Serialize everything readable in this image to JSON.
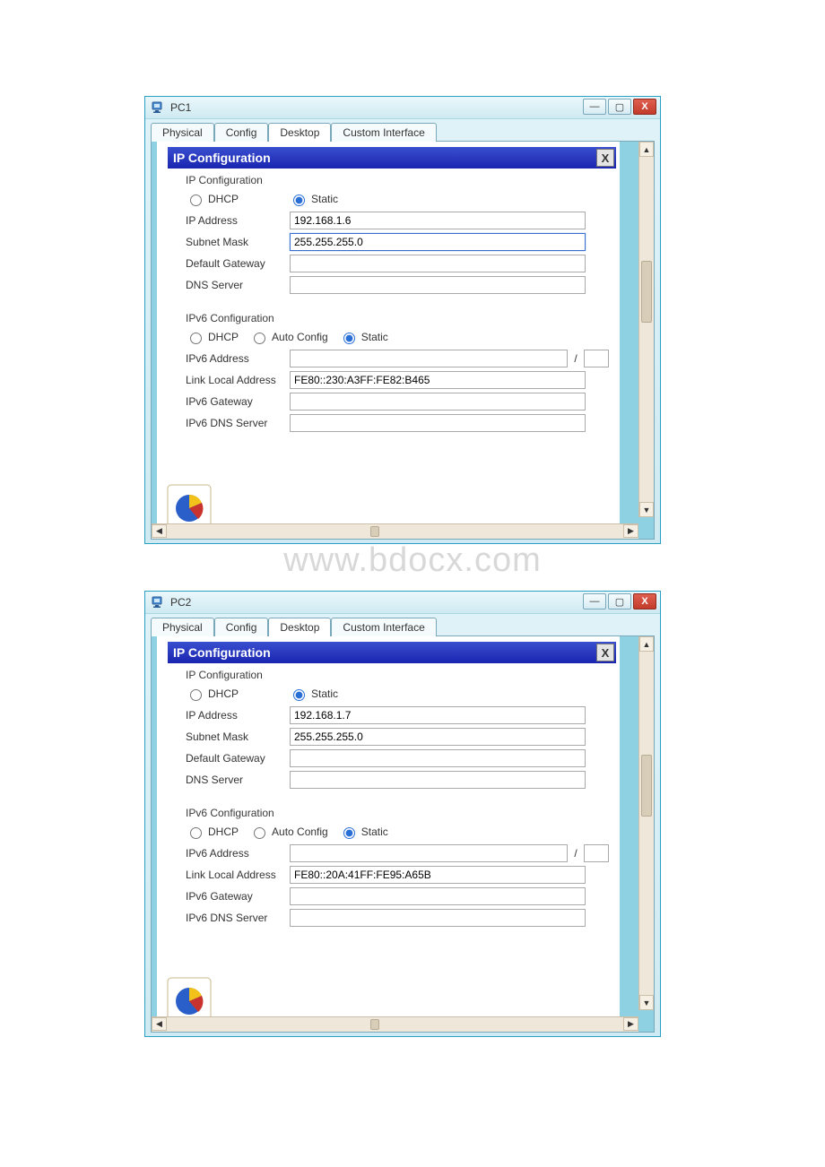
{
  "watermark": "www.bdocx.com",
  "windows": [
    {
      "key": "pc1",
      "title": "PC1",
      "tabs": [
        "Physical",
        "Config",
        "Desktop",
        "Custom Interface"
      ],
      "active_tab": "Desktop",
      "panel_title": "IP Configuration",
      "close_label": "X",
      "ipv4": {
        "legend": "IP Configuration",
        "mode_options": {
          "dhcp": "DHCP",
          "static": "Static"
        },
        "mode_selected": "static",
        "labels": {
          "ip": "IP Address",
          "mask": "Subnet Mask",
          "gw": "Default Gateway",
          "dns": "DNS Server"
        },
        "values": {
          "ip": "192.168.1.6",
          "mask": "255.255.255.0",
          "gw": "",
          "dns": ""
        },
        "focused_field": "mask"
      },
      "ipv6": {
        "legend": "IPv6 Configuration",
        "mode_options": {
          "dhcp": "DHCP",
          "auto": "Auto Config",
          "static": "Static"
        },
        "mode_selected": "static",
        "labels": {
          "addr": "IPv6 Address",
          "lla": "Link Local Address",
          "gw": "IPv6 Gateway",
          "dns": "IPv6 DNS Server"
        },
        "values": {
          "addr": "",
          "prefix": "",
          "lla": "FE80::230:A3FF:FE82:B465",
          "gw": "",
          "dns": ""
        },
        "prefix_sep": "/"
      },
      "win_controls": {
        "min": "—",
        "max": "▢",
        "close": "X"
      }
    },
    {
      "key": "pc2",
      "title": "PC2",
      "tabs": [
        "Physical",
        "Config",
        "Desktop",
        "Custom Interface"
      ],
      "active_tab": "Desktop",
      "panel_title": "IP Configuration",
      "close_label": "X",
      "ipv4": {
        "legend": "IP Configuration",
        "mode_options": {
          "dhcp": "DHCP",
          "static": "Static"
        },
        "mode_selected": "static",
        "labels": {
          "ip": "IP Address",
          "mask": "Subnet Mask",
          "gw": "Default Gateway",
          "dns": "DNS Server"
        },
        "values": {
          "ip": "192.168.1.7",
          "mask": "255.255.255.0",
          "gw": "",
          "dns": ""
        },
        "focused_field": ""
      },
      "ipv6": {
        "legend": "IPv6 Configuration",
        "mode_options": {
          "dhcp": "DHCP",
          "auto": "Auto Config",
          "static": "Static"
        },
        "mode_selected": "static",
        "labels": {
          "addr": "IPv6 Address",
          "lla": "Link Local Address",
          "gw": "IPv6 Gateway",
          "dns": "IPv6 DNS Server"
        },
        "values": {
          "addr": "",
          "prefix": "",
          "lla": "FE80::20A:41FF:FE95:A65B",
          "gw": "",
          "dns": ""
        },
        "prefix_sep": "/"
      },
      "win_controls": {
        "min": "—",
        "max": "▢",
        "close": "X"
      }
    }
  ]
}
